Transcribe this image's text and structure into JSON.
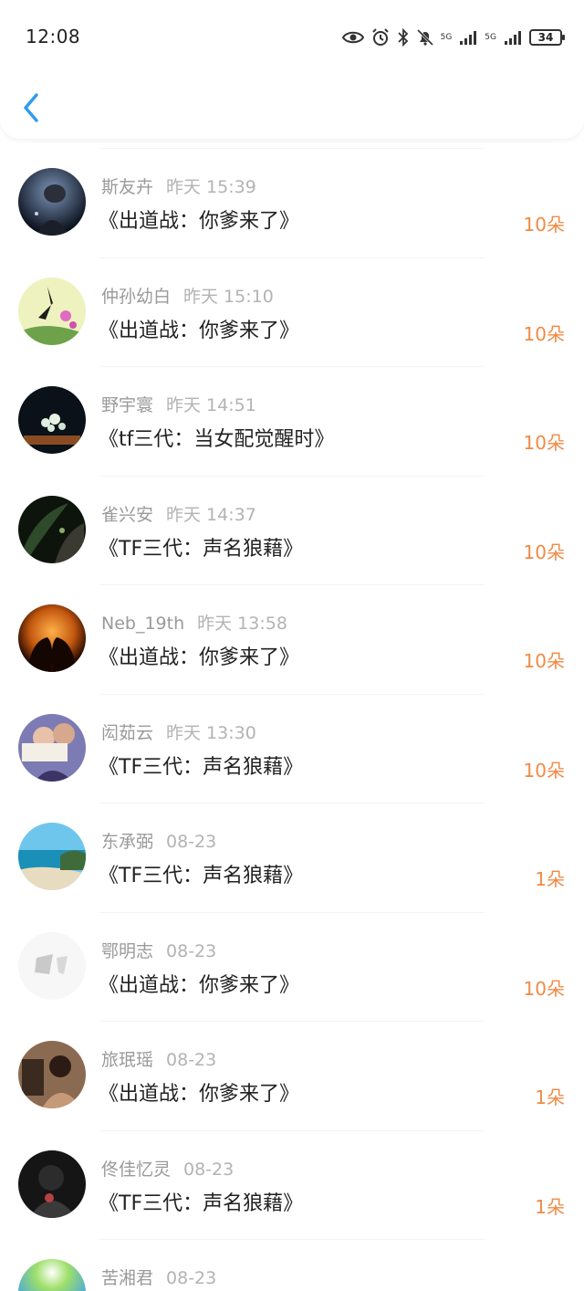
{
  "status_bar": {
    "time": "12:08",
    "net1": "5G",
    "net2": "5G",
    "battery": "34",
    "icons": [
      "eye-icon",
      "alarm-icon",
      "bluetooth-icon",
      "mute-bell-icon",
      "signal-icon",
      "signal-icon",
      "battery-icon"
    ]
  },
  "nav": {
    "back_icon": "chevron-left-icon",
    "accent": "#2e9bf0"
  },
  "colors": {
    "amount": "#f08a45",
    "name": "#9a9a9a",
    "title": "#222222"
  },
  "items": [
    {
      "name": "斯友卉",
      "date": "昨天 15:39",
      "title": "《出道战：你爹来了》",
      "amount": "10朵"
    },
    {
      "name": "仲孙幼白",
      "date": "昨天 15:10",
      "title": "《出道战：你爹来了》",
      "amount": "10朵"
    },
    {
      "name": "野宇寰",
      "date": "昨天 14:51",
      "title": "《tf三代：当女配觉醒时》",
      "amount": "10朵"
    },
    {
      "name": "雀兴安",
      "date": "昨天 14:37",
      "title": "《TF三代：声名狼藉》",
      "amount": "10朵"
    },
    {
      "name": "Neb_19th",
      "date": "昨天 13:58",
      "title": "《出道战：你爹来了》",
      "amount": "10朵"
    },
    {
      "name": "闳茹云",
      "date": "昨天 13:30",
      "title": "《TF三代：声名狼藉》",
      "amount": "10朵"
    },
    {
      "name": "东承弼",
      "date": "08-23",
      "title": "《TF三代：声名狼藉》",
      "amount": "1朵"
    },
    {
      "name": "鄂明志",
      "date": "08-23",
      "title": "《出道战：你爹来了》",
      "amount": "10朵"
    },
    {
      "name": "旅珉瑶",
      "date": "08-23",
      "title": "《出道战：你爹来了》",
      "amount": "1朵"
    },
    {
      "name": "佟佳忆灵",
      "date": "08-23",
      "title": "《TF三代：声名狼藉》",
      "amount": "1朵"
    },
    {
      "name": "苦湘君",
      "date": "08-23",
      "title": "",
      "amount": ""
    }
  ]
}
